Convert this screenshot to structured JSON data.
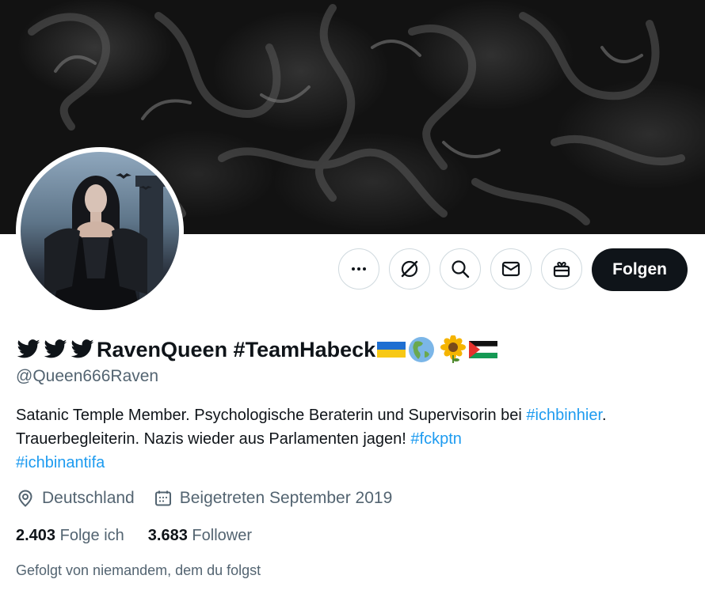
{
  "profile": {
    "display_name": "RavenQueen #TeamHabeck",
    "name_prefix_icons": [
      "twitter-bird-icon",
      "twitter-bird-icon",
      "twitter-bird-icon"
    ],
    "name_suffix_flags": [
      "ukraine-flag",
      "globe-americas",
      "sunflower",
      "palestine-flag"
    ],
    "handle": "@Queen666Raven",
    "bio": {
      "part1": "Satanic Temple Member. Psychologische Beraterin und Supervisorin bei ",
      "hashtag1": "#ichbinhier",
      "part2": ". Trauerbegleiterin. Nazis wieder aus Parlamenten jagen! ",
      "hashtag2": "#fckptn",
      "hashtag3": "#ichbinantifa"
    },
    "location": "Deutschland",
    "joined": "Beigetreten September 2019",
    "following_count": "2.403",
    "following_label": "Folge ich",
    "followers_count": "3.683",
    "followers_label": "Follower",
    "followed_by": "Gefolgt von niemandem, dem du folgst"
  },
  "actions": {
    "more_icon": "more-icon",
    "grok_icon": "grok-icon",
    "search_icon": "search-icon",
    "message_icon": "envelope-icon",
    "gift_icon": "gift-icon",
    "follow_label": "Folgen"
  },
  "colors": {
    "accent": "#1d9bf0",
    "text": "#0f1419",
    "secondary": "#536471",
    "button_dark": "#0f1419",
    "border": "#cfd9de"
  }
}
